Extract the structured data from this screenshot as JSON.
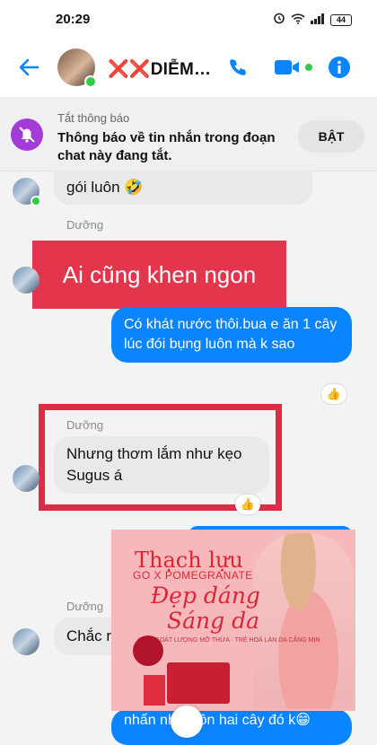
{
  "status_bar": {
    "time": "20:29",
    "battery": "44"
  },
  "header": {
    "contact_name_x": "❌❌",
    "contact_name": "DIỄM…"
  },
  "notice": {
    "caption": "Tắt thông báo",
    "message": "Thông báo về tin nhắn trong đoạn chat này đang tắt.",
    "button": "BẬT"
  },
  "chat": {
    "msg1": "gói luôn 🤣",
    "sender1": "Dưỡng",
    "banner": "Ai cũng khen ngon",
    "out1": "Có khát nước thôi.bua e ăn 1 cây lúc đói bụng luôn mà k sao",
    "reaction1": "👍",
    "sender2": "Dưỡng",
    "msg2": "Nhưng thơm lắm như kẹo Sugus á",
    "sender3": "Dưỡng",
    "msg3": "Chắc r",
    "out2_partial": "nhấn nhá luôn hai cây đó k😁"
  },
  "ad": {
    "title": "Thạch lựu",
    "subtitle": "GO X POMEGRANATE",
    "slogan1": "Đẹp dáng",
    "slogan2": "Sáng da",
    "fine_print": "KIỂM SOÁT LƯỢNG MỠ THỪA · TRẺ HOÁ LÀN DA CĂNG MỊN"
  },
  "colors": {
    "brand_blue": "#0a84ff",
    "highlight_red": "#e3354c"
  }
}
